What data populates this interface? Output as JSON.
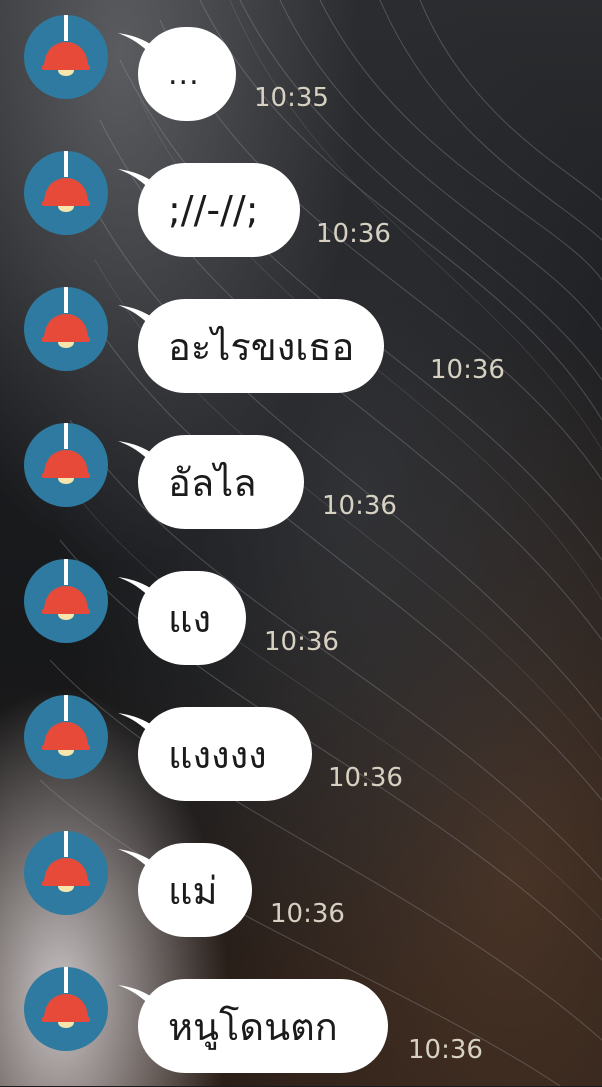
{
  "messages": [
    {
      "text": "...",
      "time": "10:35"
    },
    {
      "text": ";//-//;",
      "time": "10:36"
    },
    {
      "text": "อะไรขงเธอ",
      "time": "10:36"
    },
    {
      "text": "อัลไล",
      "time": "10:36"
    },
    {
      "text": "แง",
      "time": "10:36"
    },
    {
      "text": "แงงงง",
      "time": "10:36"
    },
    {
      "text": "แม่",
      "time": "10:36"
    },
    {
      "text": "หนูโดนตก",
      "time": "10:36"
    }
  ],
  "avatar_icon": "lamp-icon",
  "colors": {
    "avatar_bg": "#2f7aa0",
    "lamp_shade": "#e84a3a",
    "bubble": "#ffffff",
    "time_text": "#d7d1c2"
  }
}
